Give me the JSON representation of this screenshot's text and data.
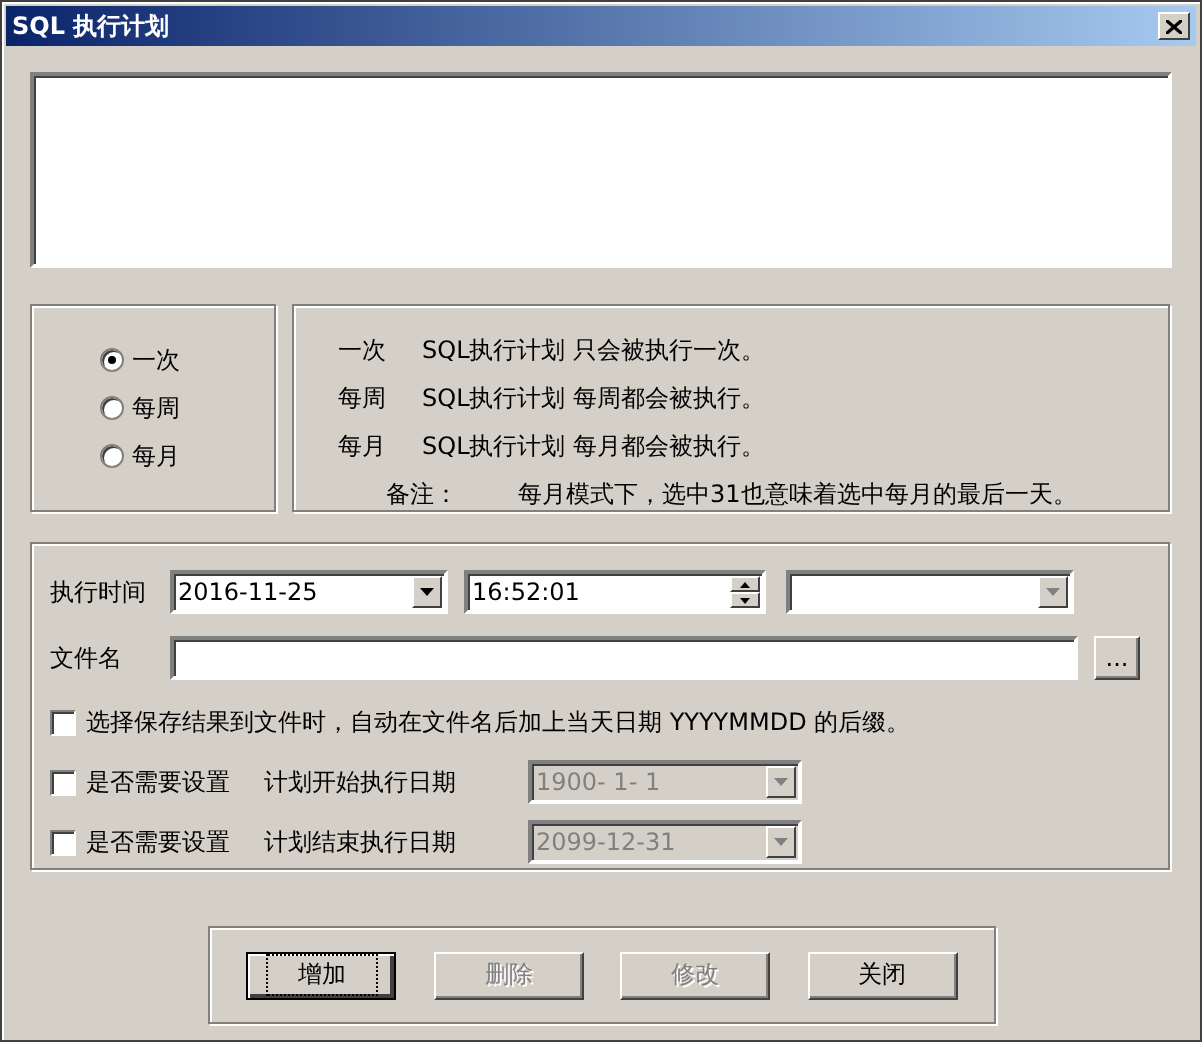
{
  "window": {
    "title": "SQL 执行计划"
  },
  "frequency": [
    {
      "label": "一次",
      "selected": true
    },
    {
      "label": "每周",
      "selected": false
    },
    {
      "label": "每月",
      "selected": false
    }
  ],
  "descriptions": [
    {
      "term": "一次",
      "text": "SQL执行计划 只会被执行一次。"
    },
    {
      "term": "每周",
      "text": "SQL执行计划 每周都会被执行。"
    },
    {
      "term": "每月",
      "text": "SQL执行计划 每月都会被执行。"
    }
  ],
  "note": {
    "label": "备注：",
    "text": "每月模式下，选中31也意味着选中每月的最后一天。"
  },
  "schedule": {
    "time_label": "执行时间",
    "date": "2016-11-25",
    "time": "16:52:01",
    "file_label": "文件名",
    "browse": "...",
    "append_date": {
      "label": "选择保存结果到文件时，自动在文件名后加上当天日期 YYYYMMDD 的后缀。",
      "checked": false
    },
    "ranges": [
      {
        "label": "是否需要设置",
        "caption": "计划开始执行日期",
        "value": "1900- 1- 1",
        "checked": false,
        "disabled": true
      },
      {
        "label": "是否需要设置",
        "caption": "计划结束执行日期",
        "value": "2099-12-31",
        "checked": false,
        "disabled": true
      }
    ]
  },
  "buttons": [
    {
      "label": "增加",
      "disabled": false,
      "focused": true
    },
    {
      "label": "删除",
      "disabled": true,
      "focused": false
    },
    {
      "label": "修改",
      "disabled": true,
      "focused": false
    },
    {
      "label": "关闭",
      "disabled": false,
      "focused": false
    }
  ]
}
